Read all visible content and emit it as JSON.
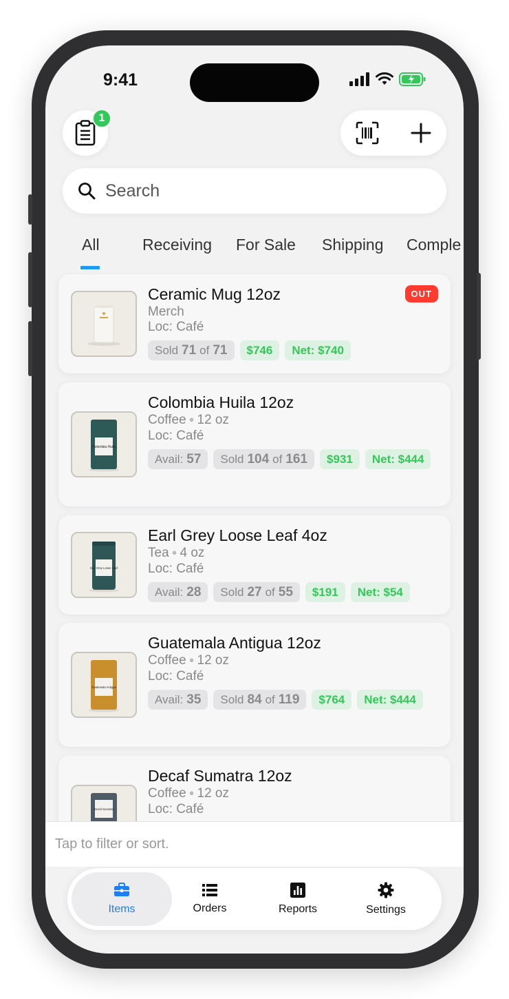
{
  "status": {
    "time": "9:41"
  },
  "header": {
    "clipboard_badge": "1"
  },
  "search": {
    "placeholder": "Search"
  },
  "tabs": [
    "All",
    "Receiving",
    "For Sale",
    "Shipping",
    "Comple"
  ],
  "items": [
    {
      "name": "Ceramic Mug 12oz",
      "category": "Merch",
      "size": "",
      "location": "Loc: Café",
      "status_badge": "OUT",
      "avail_label": "",
      "avail_value": "",
      "sold_label": "Sold",
      "sold_value": "71",
      "sold_of": "of",
      "sold_total": "71",
      "revenue": "$746",
      "net": "Net: $740",
      "thumb_text": "",
      "thumb_kind": "mug"
    },
    {
      "name": "Colombia Huila 12oz",
      "category": "Coffee",
      "size": "12 oz",
      "location": "Loc: Café",
      "status_badge": "",
      "avail_label": "Avail:",
      "avail_value": "57",
      "sold_label": "Sold",
      "sold_value": "104",
      "sold_of": "of",
      "sold_total": "161",
      "revenue": "$931",
      "net": "Net: $444",
      "thumb_text": "Colombia Huila",
      "thumb_kind": "bag-teal"
    },
    {
      "name": "Earl Grey Loose Leaf 4oz",
      "category": "Tea",
      "size": "4 oz",
      "location": "Loc: Café",
      "status_badge": "",
      "avail_label": "Avail:",
      "avail_value": "28",
      "sold_label": "Sold",
      "sold_value": "27",
      "sold_of": "of",
      "sold_total": "55",
      "revenue": "$191",
      "net": "Net: $54",
      "thumb_text": "Earl Grey Loose Leaf",
      "thumb_kind": "tin"
    },
    {
      "name": "Guatemala Antigua 12oz",
      "category": "Coffee",
      "size": "12 oz",
      "location": "Loc: Café",
      "status_badge": "",
      "avail_label": "Avail:",
      "avail_value": "35",
      "sold_label": "Sold",
      "sold_value": "84",
      "sold_of": "of",
      "sold_total": "119",
      "revenue": "$764",
      "net": "Net: $444",
      "thumb_text": "Guatemala Antigua",
      "thumb_kind": "bag-gold"
    },
    {
      "name": "Decaf Sumatra 12oz",
      "category": "Coffee",
      "size": "12 oz",
      "location": "Loc: Café",
      "status_badge": "",
      "thumb_text": "Decaf Sumatra",
      "thumb_kind": "bag-slate"
    }
  ],
  "filter_bar": {
    "hint": "Tap to filter or sort."
  },
  "tab_bar": {
    "items": {
      "label": "Items",
      "icon": "briefcase-icon"
    },
    "orders": {
      "label": "Orders",
      "icon": "list-icon"
    },
    "reports": {
      "label": "Reports",
      "icon": "bar-chart-icon"
    },
    "settings": {
      "label": "Settings",
      "icon": "gear-icon"
    }
  },
  "colors": {
    "accent": "#1e7ff0",
    "green": "#34c759",
    "red": "#ff3b30"
  }
}
